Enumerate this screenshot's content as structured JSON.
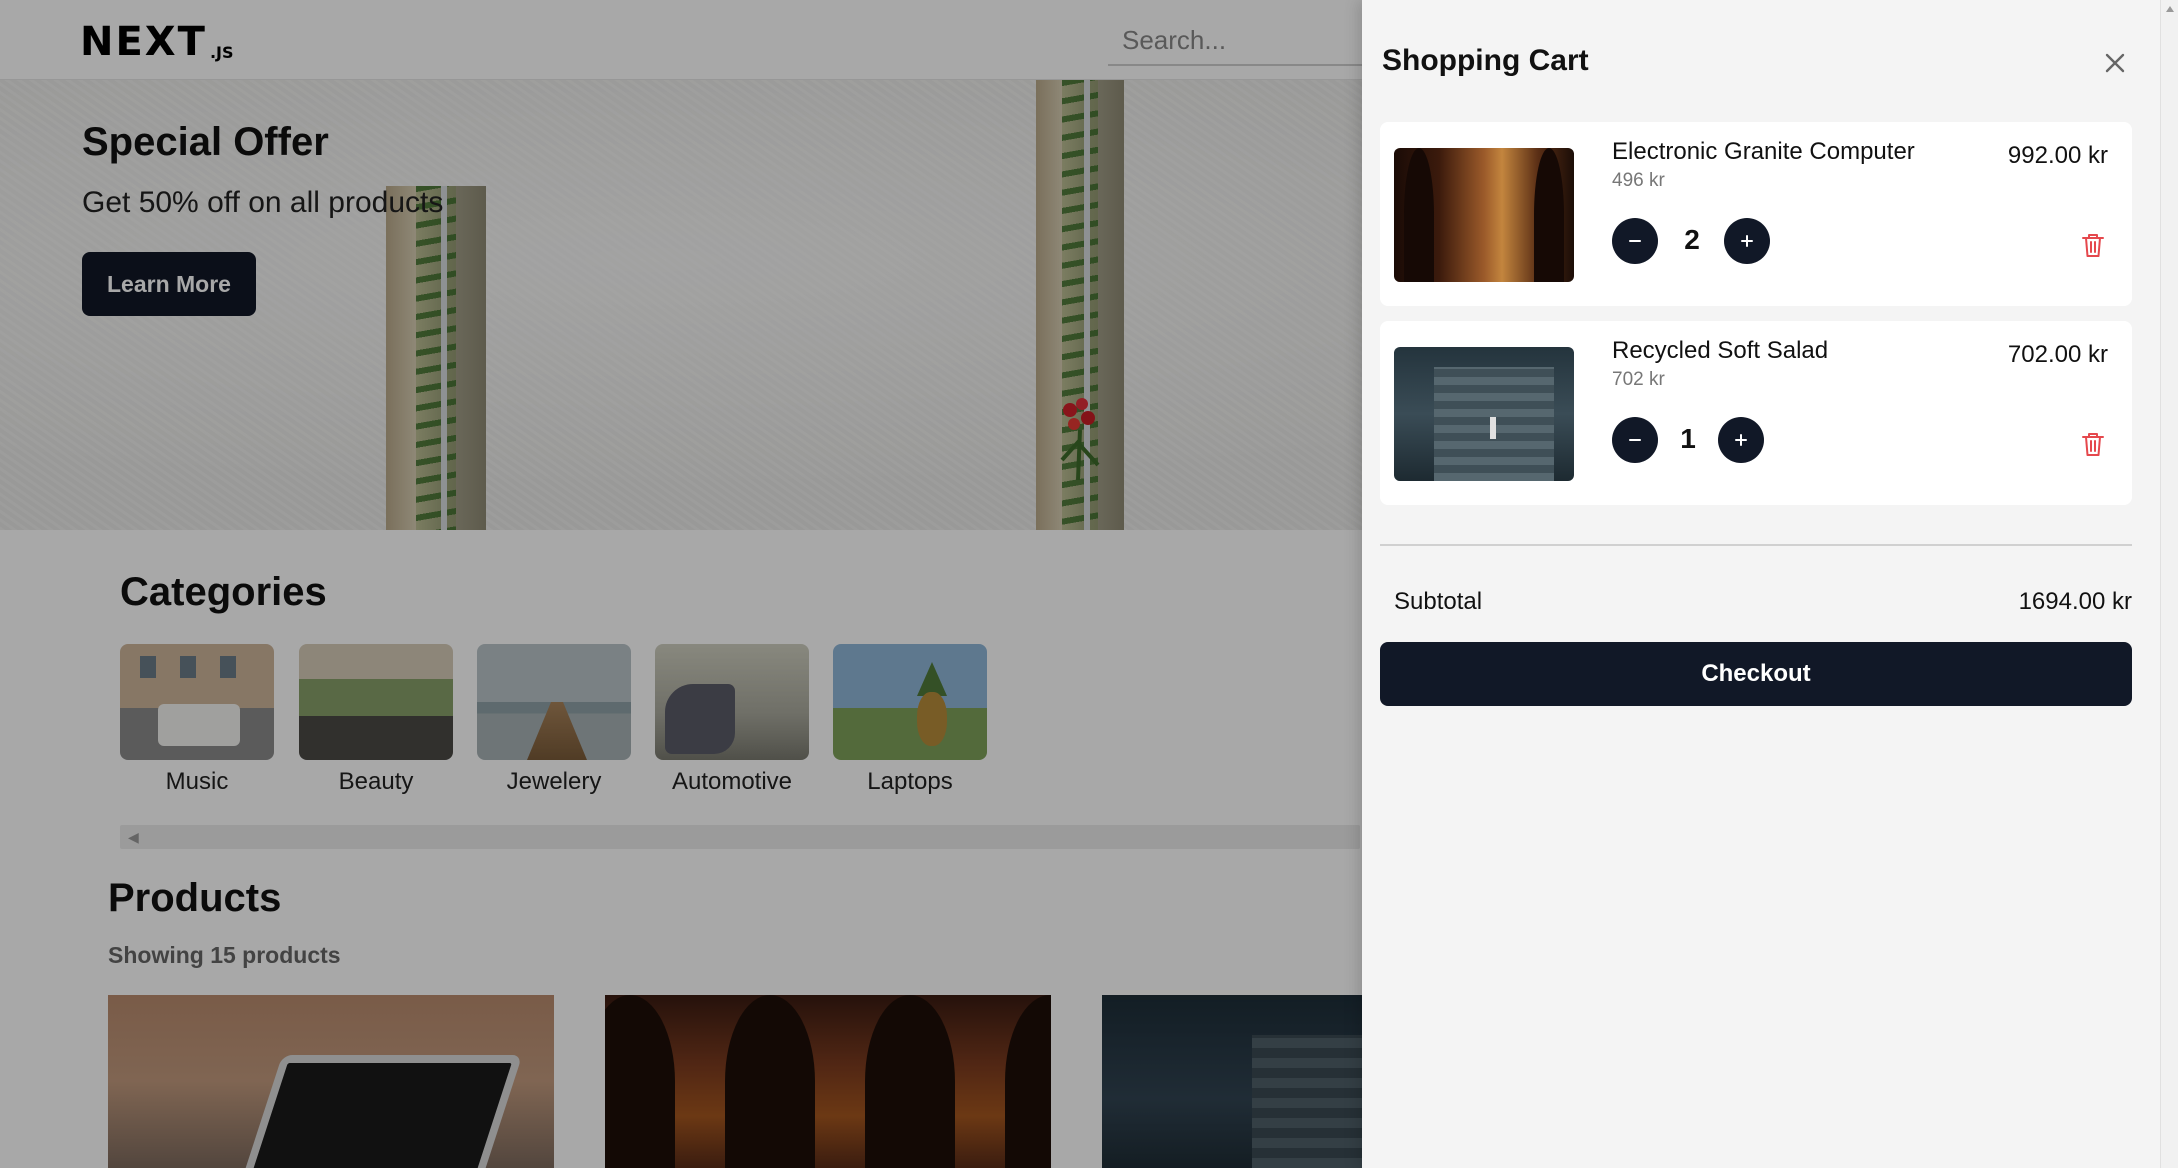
{
  "header": {
    "logo_main": "NEXT",
    "logo_sub": ".JS",
    "search_placeholder": "Search..."
  },
  "hero": {
    "title": "Special Offer",
    "subtitle": "Get 50% off on all products",
    "button_label": "Learn More"
  },
  "categories": {
    "title": "Categories",
    "items": [
      {
        "label": "Music"
      },
      {
        "label": "Beauty"
      },
      {
        "label": "Jewelery"
      },
      {
        "label": "Automotive"
      },
      {
        "label": "Laptops"
      }
    ]
  },
  "products": {
    "title": "Products",
    "count_text": "Showing 15 products"
  },
  "cart": {
    "title": "Shopping Cart",
    "items": [
      {
        "name": "Electronic Granite Computer",
        "unit_price": "496 kr",
        "quantity": "2",
        "line_total": "992.00 kr"
      },
      {
        "name": "Recycled Soft Salad",
        "unit_price": "702 kr",
        "quantity": "1",
        "line_total": "702.00 kr"
      }
    ],
    "subtotal_label": "Subtotal",
    "subtotal_value": "1694.00 kr",
    "checkout_label": "Checkout"
  },
  "colors": {
    "primary_dark": "#111827",
    "drawer_bg": "#f4f4f4",
    "trash_red": "#e5484d"
  },
  "icons": {
    "close": "close-icon",
    "minus": "minus-icon",
    "plus": "plus-icon",
    "trash": "trash-icon"
  }
}
